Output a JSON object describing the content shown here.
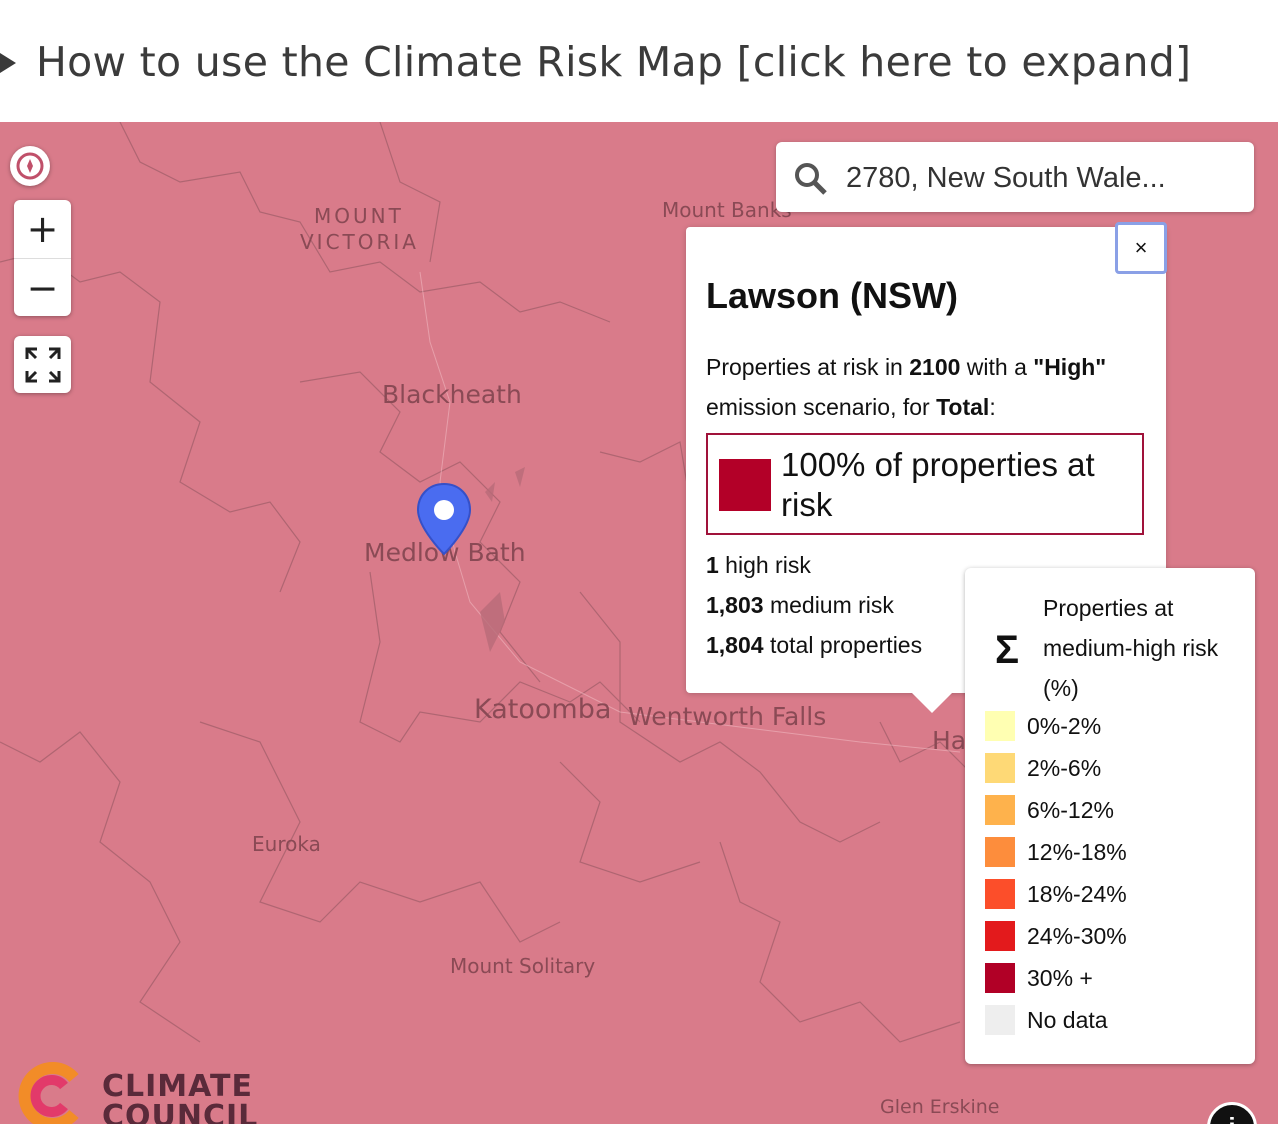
{
  "header": {
    "expander_label": "How to use the Climate Risk Map [click here to expand]"
  },
  "search": {
    "value": "2780, New South Wale..."
  },
  "controls": {
    "zoom_in": "+",
    "zoom_out": "−"
  },
  "places": {
    "mount_victoria_1": "MOUNT",
    "mount_victoria_2": "VICTORIA",
    "mount_banks": "Mount Banks",
    "blackheath": "Blackheath",
    "medlow_bath": "Medlow Bath",
    "katoomba": "Katoomba",
    "wentworth_falls": "Wentworth Falls",
    "hazelbrook_partial": "Ha",
    "euroka": "Euroka",
    "mount_solitary": "Mount Solitary",
    "glen_erskine": "Glen Erskine"
  },
  "popup": {
    "close": "×",
    "title": "Lawson (NSW)",
    "desc_prefix": "Properties at risk in ",
    "year": "2100",
    "desc_mid": " with a ",
    "scenario": "\"High\"",
    "desc_line2": "emission scenario, for ",
    "category": "Total",
    "colon": ":",
    "risk_text": "100% of properties at risk",
    "risk_color": "#b30028",
    "high_count": "1",
    "high_label": " high risk",
    "medium_count": "1,803",
    "medium_label": " medium risk",
    "total_count": "1,804",
    "total_label": " total properties"
  },
  "legend": {
    "sigma": "Σ",
    "title": "Properties at medium-high risk (%)",
    "items": [
      {
        "label": "0%-2%",
        "color": "#ffffb2"
      },
      {
        "label": "2%-6%",
        "color": "#fed976"
      },
      {
        "label": "6%-12%",
        "color": "#feb24c"
      },
      {
        "label": "12%-18%",
        "color": "#fd8d3c"
      },
      {
        "label": "18%-24%",
        "color": "#fc4e2a"
      },
      {
        "label": "24%-30%",
        "color": "#e31a1c"
      },
      {
        "label": "30% +",
        "color": "#b10026"
      },
      {
        "label": "No data",
        "color": "#eeeeee"
      }
    ]
  },
  "logo": {
    "line1": "CLIMATE",
    "line2": "COUNCIL"
  },
  "info_button": "i",
  "colors": {
    "map_fill": "#d97b8a",
    "pin": "#4a6cf0"
  }
}
